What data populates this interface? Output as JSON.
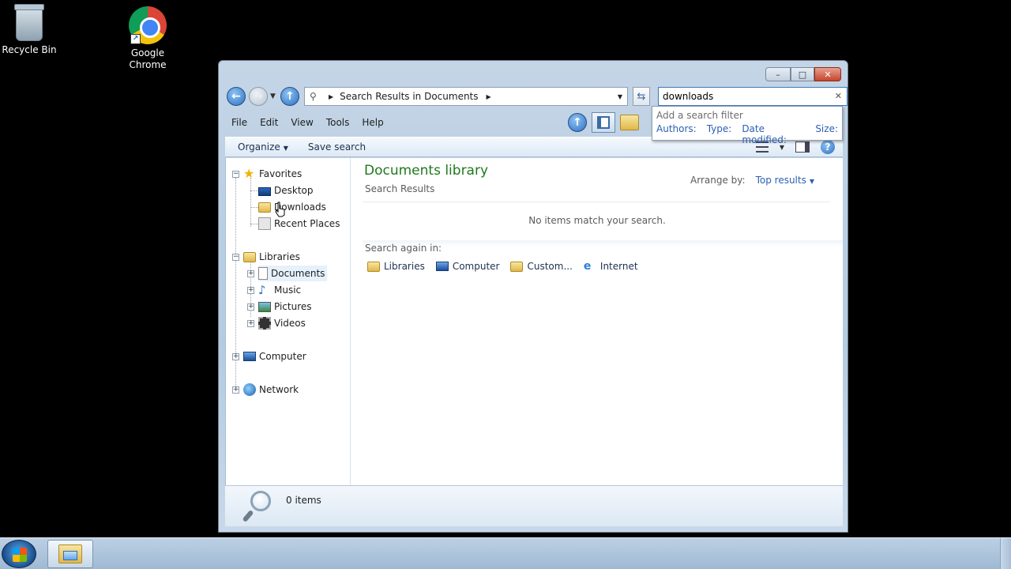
{
  "desktop": {
    "icons": [
      {
        "label": "Recycle Bin",
        "icon": "recycle-bin-icon"
      },
      {
        "label": "Google Chrome",
        "icon": "chrome-icon"
      }
    ]
  },
  "window": {
    "caption": {
      "minimize": "–",
      "maximize": "□",
      "close": "✕"
    },
    "address": {
      "path": "Search Results in Documents"
    },
    "search": {
      "value": "downloads"
    },
    "filter_popup": {
      "hint": "Add a search filter",
      "filters": [
        "Authors:",
        "Type:",
        "Date modified:",
        "Size:"
      ]
    },
    "menu": [
      "File",
      "Edit",
      "View",
      "Tools",
      "Help"
    ],
    "commands": {
      "organize": "Organize",
      "save_search": "Save search"
    },
    "nav_pane": {
      "favorites": {
        "label": "Favorites",
        "items": [
          "Desktop",
          "Downloads",
          "Recent Places"
        ]
      },
      "libraries": {
        "label": "Libraries",
        "items": [
          "Documents",
          "Music",
          "Pictures",
          "Videos"
        ]
      },
      "computer": "Computer",
      "network": "Network"
    },
    "main": {
      "title": "Documents library",
      "subtitle": "Search Results",
      "arrange_label": "Arrange by:",
      "arrange_value": "Top results",
      "empty_message": "No items match your search.",
      "search_again_label": "Search again in:",
      "search_again": [
        {
          "label": "Libraries",
          "icon": "libraries-icon"
        },
        {
          "label": "Computer",
          "icon": "computer-icon"
        },
        {
          "label": "Custom...",
          "icon": "custom-folder-icon"
        },
        {
          "label": "Internet",
          "icon": "internet-explorer-icon"
        }
      ]
    },
    "details": {
      "count": "0 items"
    }
  }
}
